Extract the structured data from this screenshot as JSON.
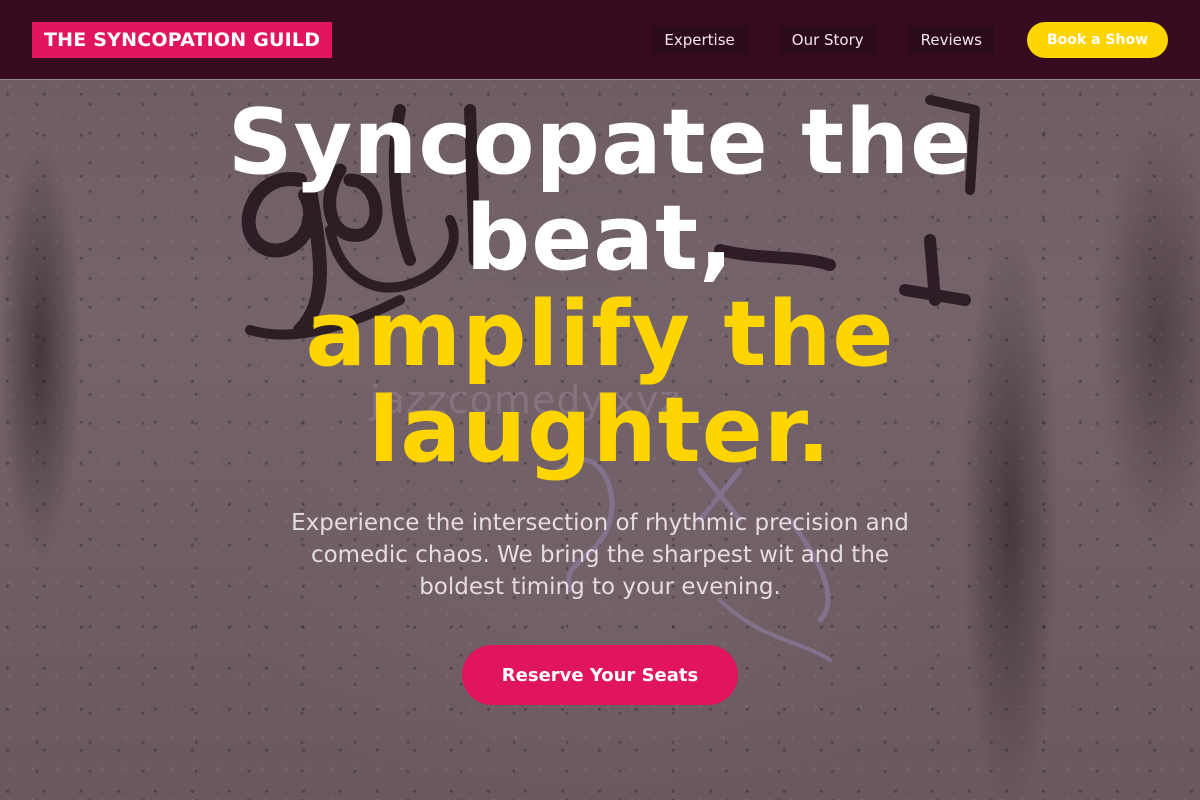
{
  "brand": {
    "name": "THE SYNCOPATION GUILD",
    "accent": "#e0155d",
    "highlight": "#ffd500",
    "header_bg": "#360a1f"
  },
  "nav": {
    "links": [
      "Expertise",
      "Our Story",
      "Reviews"
    ],
    "cta": "Book a Show"
  },
  "hero": {
    "headline_white_1": "Syncopate the",
    "headline_white_2": "beat,",
    "headline_yellow_1": "amplify the",
    "headline_yellow_2": "laughter.",
    "subtitle": "Experience the intersection of rhythmic precision and comedic chaos. We bring the sharpest wit and the boldest timing to your evening.",
    "cta": "Reserve Your Seats"
  },
  "background": {
    "watermark": "jazzcomedy.xyz",
    "icon": "graffiti-wall"
  }
}
